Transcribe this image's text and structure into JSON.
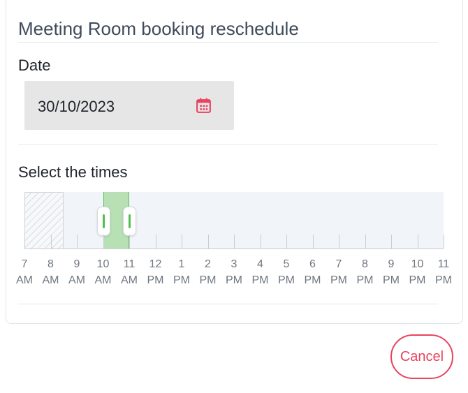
{
  "dialog": {
    "title": "Meeting Room booking reschedule",
    "date_label": "Date",
    "date_value": "30/10/2023",
    "times_label": "Select the times"
  },
  "timeline": {
    "hours": [
      {
        "num": "7",
        "ampm": "AM"
      },
      {
        "num": "8",
        "ampm": "AM"
      },
      {
        "num": "9",
        "ampm": "AM"
      },
      {
        "num": "10",
        "ampm": "AM"
      },
      {
        "num": "11",
        "ampm": "AM"
      },
      {
        "num": "12",
        "ampm": "PM"
      },
      {
        "num": "1",
        "ampm": "PM"
      },
      {
        "num": "2",
        "ampm": "PM"
      },
      {
        "num": "3",
        "ampm": "PM"
      },
      {
        "num": "4",
        "ampm": "PM"
      },
      {
        "num": "5",
        "ampm": "PM"
      },
      {
        "num": "6",
        "ampm": "PM"
      },
      {
        "num": "7",
        "ampm": "PM"
      },
      {
        "num": "8",
        "ampm": "PM"
      },
      {
        "num": "9",
        "ampm": "PM"
      },
      {
        "num": "10",
        "ampm": "PM"
      },
      {
        "num": "11",
        "ampm": "PM"
      }
    ],
    "unavailable_until_hour": 8.5,
    "selected_start_hour": 10,
    "selected_end_hour": 11
  },
  "actions": {
    "cancel_label": "Cancel"
  },
  "colors": {
    "accent": "#e9435f",
    "selection": "#b7e1b4",
    "selection_border": "#5cc15b"
  },
  "icons": {
    "date_picker": "calendar-icon"
  }
}
